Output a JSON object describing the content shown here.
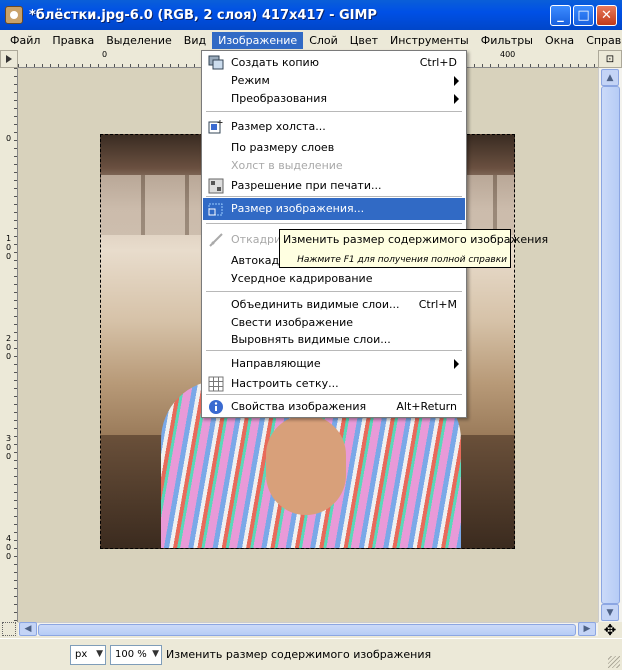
{
  "window": {
    "title": "*блёстки.jpg-6.0 (RGB, 2 слоя) 417x417 - GIMP",
    "minimize_label": "_",
    "maximize_label": "□",
    "close_label": "✕"
  },
  "menubar": {
    "items": [
      "Файл",
      "Правка",
      "Выделение",
      "Вид",
      "Изображение",
      "Слой",
      "Цвет",
      "Инструменты",
      "Фильтры",
      "Окна",
      "Справка"
    ],
    "active": "Изображение"
  },
  "rulers": {
    "h_labels": [
      "0",
      "400"
    ],
    "v_labels": [
      "0",
      "100",
      "200",
      "300",
      "400"
    ]
  },
  "image_menu": {
    "items": [
      {
        "label": "Создать копию",
        "shortcut": "Ctrl+D",
        "icon": "duplicate-icon"
      },
      {
        "label": "Режим",
        "submenu": true
      },
      {
        "label": "Преобразования",
        "submenu": true
      },
      {
        "label": "Размер холста...",
        "icon": "canvas-size-icon"
      },
      {
        "label": "По размеру слоев"
      },
      {
        "label": "Холст в выделение",
        "disabled": true
      },
      {
        "label": "Разрешение при печати...",
        "icon": "print-resolution-icon"
      },
      {
        "label": "Размер изображения...",
        "icon": "scale-image-icon",
        "highlighted": true
      },
      {
        "label": "Откадрировать",
        "disabled": true,
        "icon": "crop-icon"
      },
      {
        "label": "Автокадрирование"
      },
      {
        "label": "Усердное кадрирование"
      },
      {
        "label": "Объединить видимые слои...",
        "shortcut": "Ctrl+M"
      },
      {
        "label": "Свести изображение"
      },
      {
        "label": "Выровнять видимые слои..."
      },
      {
        "label": "Направляющие",
        "submenu": true
      },
      {
        "label": "Настроить сетку...",
        "icon": "grid-icon"
      },
      {
        "label": "Свойства изображения",
        "shortcut": "Alt+Return",
        "icon": "info-icon"
      }
    ]
  },
  "tooltip": {
    "text": "Изменить размер содержимого изображения",
    "hint": "Нажмите F1 для получения полной справки"
  },
  "statusbar": {
    "unit": "px",
    "zoom": "100 %",
    "message": "Изменить размер содержимого изображения"
  },
  "colors": {
    "titlebar": "#0a5fd8",
    "highlight": "#316ac5",
    "tooltip_bg": "#ffffe1"
  }
}
